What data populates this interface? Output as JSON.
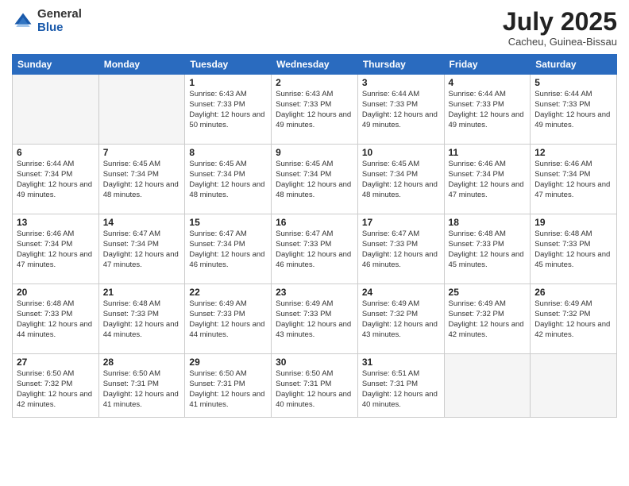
{
  "logo": {
    "general": "General",
    "blue": "Blue"
  },
  "title": "July 2025",
  "location": "Cacheu, Guinea-Bissau",
  "days_of_week": [
    "Sunday",
    "Monday",
    "Tuesday",
    "Wednesday",
    "Thursday",
    "Friday",
    "Saturday"
  ],
  "weeks": [
    [
      {
        "day": "",
        "info": ""
      },
      {
        "day": "",
        "info": ""
      },
      {
        "day": "1",
        "info": "Sunrise: 6:43 AM\nSunset: 7:33 PM\nDaylight: 12 hours and 50 minutes."
      },
      {
        "day": "2",
        "info": "Sunrise: 6:43 AM\nSunset: 7:33 PM\nDaylight: 12 hours and 49 minutes."
      },
      {
        "day": "3",
        "info": "Sunrise: 6:44 AM\nSunset: 7:33 PM\nDaylight: 12 hours and 49 minutes."
      },
      {
        "day": "4",
        "info": "Sunrise: 6:44 AM\nSunset: 7:33 PM\nDaylight: 12 hours and 49 minutes."
      },
      {
        "day": "5",
        "info": "Sunrise: 6:44 AM\nSunset: 7:33 PM\nDaylight: 12 hours and 49 minutes."
      }
    ],
    [
      {
        "day": "6",
        "info": "Sunrise: 6:44 AM\nSunset: 7:34 PM\nDaylight: 12 hours and 49 minutes."
      },
      {
        "day": "7",
        "info": "Sunrise: 6:45 AM\nSunset: 7:34 PM\nDaylight: 12 hours and 48 minutes."
      },
      {
        "day": "8",
        "info": "Sunrise: 6:45 AM\nSunset: 7:34 PM\nDaylight: 12 hours and 48 minutes."
      },
      {
        "day": "9",
        "info": "Sunrise: 6:45 AM\nSunset: 7:34 PM\nDaylight: 12 hours and 48 minutes."
      },
      {
        "day": "10",
        "info": "Sunrise: 6:45 AM\nSunset: 7:34 PM\nDaylight: 12 hours and 48 minutes."
      },
      {
        "day": "11",
        "info": "Sunrise: 6:46 AM\nSunset: 7:34 PM\nDaylight: 12 hours and 47 minutes."
      },
      {
        "day": "12",
        "info": "Sunrise: 6:46 AM\nSunset: 7:34 PM\nDaylight: 12 hours and 47 minutes."
      }
    ],
    [
      {
        "day": "13",
        "info": "Sunrise: 6:46 AM\nSunset: 7:34 PM\nDaylight: 12 hours and 47 minutes."
      },
      {
        "day": "14",
        "info": "Sunrise: 6:47 AM\nSunset: 7:34 PM\nDaylight: 12 hours and 47 minutes."
      },
      {
        "day": "15",
        "info": "Sunrise: 6:47 AM\nSunset: 7:34 PM\nDaylight: 12 hours and 46 minutes."
      },
      {
        "day": "16",
        "info": "Sunrise: 6:47 AM\nSunset: 7:33 PM\nDaylight: 12 hours and 46 minutes."
      },
      {
        "day": "17",
        "info": "Sunrise: 6:47 AM\nSunset: 7:33 PM\nDaylight: 12 hours and 46 minutes."
      },
      {
        "day": "18",
        "info": "Sunrise: 6:48 AM\nSunset: 7:33 PM\nDaylight: 12 hours and 45 minutes."
      },
      {
        "day": "19",
        "info": "Sunrise: 6:48 AM\nSunset: 7:33 PM\nDaylight: 12 hours and 45 minutes."
      }
    ],
    [
      {
        "day": "20",
        "info": "Sunrise: 6:48 AM\nSunset: 7:33 PM\nDaylight: 12 hours and 44 minutes."
      },
      {
        "day": "21",
        "info": "Sunrise: 6:48 AM\nSunset: 7:33 PM\nDaylight: 12 hours and 44 minutes."
      },
      {
        "day": "22",
        "info": "Sunrise: 6:49 AM\nSunset: 7:33 PM\nDaylight: 12 hours and 44 minutes."
      },
      {
        "day": "23",
        "info": "Sunrise: 6:49 AM\nSunset: 7:33 PM\nDaylight: 12 hours and 43 minutes."
      },
      {
        "day": "24",
        "info": "Sunrise: 6:49 AM\nSunset: 7:32 PM\nDaylight: 12 hours and 43 minutes."
      },
      {
        "day": "25",
        "info": "Sunrise: 6:49 AM\nSunset: 7:32 PM\nDaylight: 12 hours and 42 minutes."
      },
      {
        "day": "26",
        "info": "Sunrise: 6:49 AM\nSunset: 7:32 PM\nDaylight: 12 hours and 42 minutes."
      }
    ],
    [
      {
        "day": "27",
        "info": "Sunrise: 6:50 AM\nSunset: 7:32 PM\nDaylight: 12 hours and 42 minutes."
      },
      {
        "day": "28",
        "info": "Sunrise: 6:50 AM\nSunset: 7:31 PM\nDaylight: 12 hours and 41 minutes."
      },
      {
        "day": "29",
        "info": "Sunrise: 6:50 AM\nSunset: 7:31 PM\nDaylight: 12 hours and 41 minutes."
      },
      {
        "day": "30",
        "info": "Sunrise: 6:50 AM\nSunset: 7:31 PM\nDaylight: 12 hours and 40 minutes."
      },
      {
        "day": "31",
        "info": "Sunrise: 6:51 AM\nSunset: 7:31 PM\nDaylight: 12 hours and 40 minutes."
      },
      {
        "day": "",
        "info": ""
      },
      {
        "day": "",
        "info": ""
      }
    ]
  ]
}
